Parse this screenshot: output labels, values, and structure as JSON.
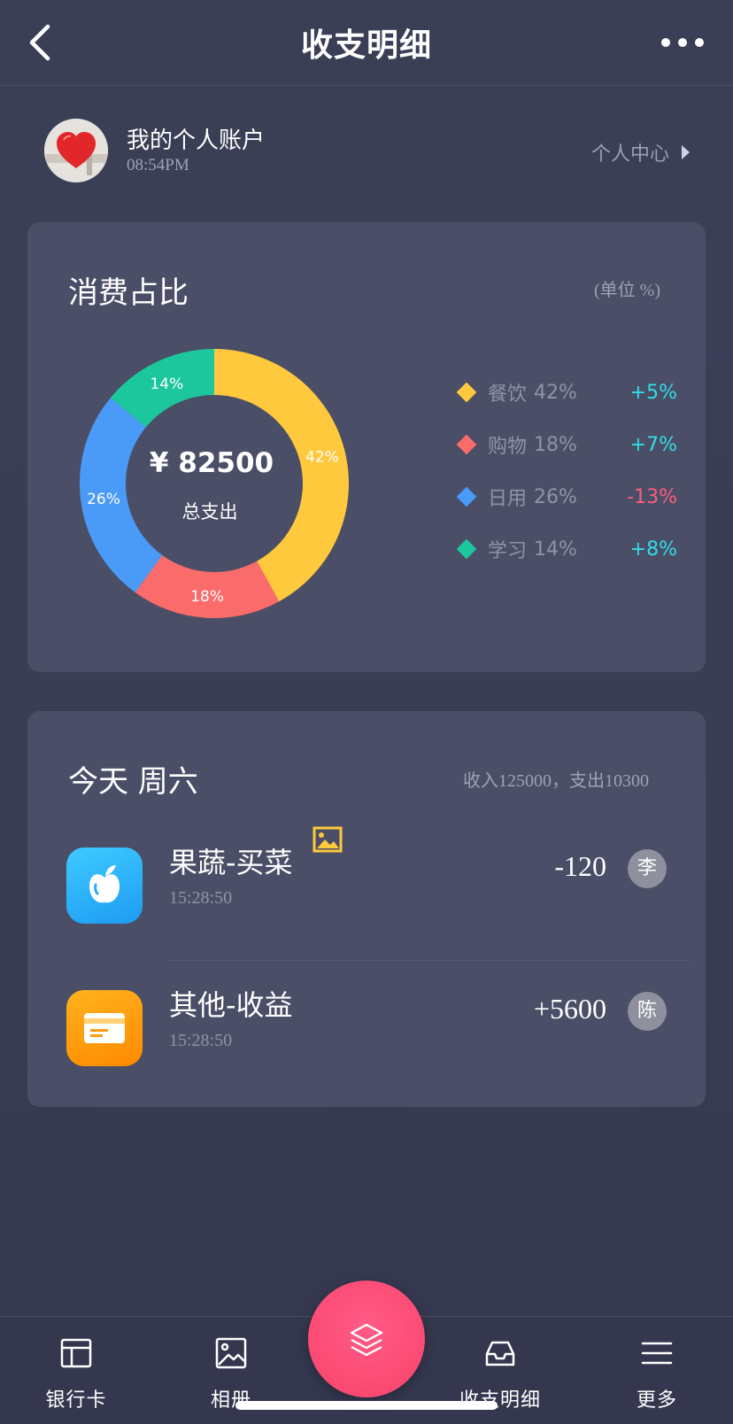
{
  "nav": {
    "title": "收支明细"
  },
  "account": {
    "name": "我的个人账户",
    "time": "08:54PM",
    "personal_center": "个人中心"
  },
  "chart_card": {
    "title": "消费占比",
    "unit": "(单位 %)",
    "total_amount": "¥ 82500",
    "total_label": "总支出",
    "slice_labels": [
      "42%",
      "18%",
      "26%",
      "14%"
    ],
    "legend": [
      {
        "label": "餐饮",
        "pct": "42%",
        "change": "+5%",
        "color": "#ffc93d",
        "change_color": "#32dde8"
      },
      {
        "label": "购物",
        "pct": "18%",
        "change": "+7%",
        "color": "#fa6b6b",
        "change_color": "#32dde8"
      },
      {
        "label": "日用",
        "pct": "26%",
        "change": "-13%",
        "color": "#4a9af7",
        "change_color": "#ff5d7e"
      },
      {
        "label": "学习",
        "pct": "14%",
        "change": "+8%",
        "color": "#1cc79d",
        "change_color": "#32dde8"
      }
    ]
  },
  "chart_data": {
    "type": "pie",
    "categories": [
      "餐饮",
      "购物",
      "日用",
      "学习"
    ],
    "values": [
      42,
      18,
      26,
      14
    ],
    "colors": [
      "#ffc93d",
      "#fa6b6b",
      "#4a9af7",
      "#1cc79d"
    ],
    "title": "消费占比",
    "unit": "(单位 %)",
    "center_text": [
      "¥ 82500",
      "总支出"
    ],
    "legend_placement": "right"
  },
  "today_card": {
    "title": "今天 周六",
    "summary": "收入125000，支出10300",
    "transactions": [
      {
        "title": "果蔬-买菜",
        "time": "15:28:50",
        "amount": "-120",
        "user": "李",
        "icon": "apple-icon",
        "has_photo": true
      },
      {
        "title": "其他-收益",
        "time": "15:28:50",
        "amount": "+5600",
        "user": "陈",
        "icon": "card-icon",
        "has_photo": false
      }
    ]
  },
  "tabbar": {
    "items": [
      {
        "label": "银行卡",
        "icon": "bank-card-icon"
      },
      {
        "label": "相册",
        "icon": "album-icon"
      },
      {
        "label": "收支明细",
        "icon": "inbox-icon"
      },
      {
        "label": "更多",
        "icon": "menu-icon"
      }
    ],
    "fab_icon": "layers-icon"
  }
}
